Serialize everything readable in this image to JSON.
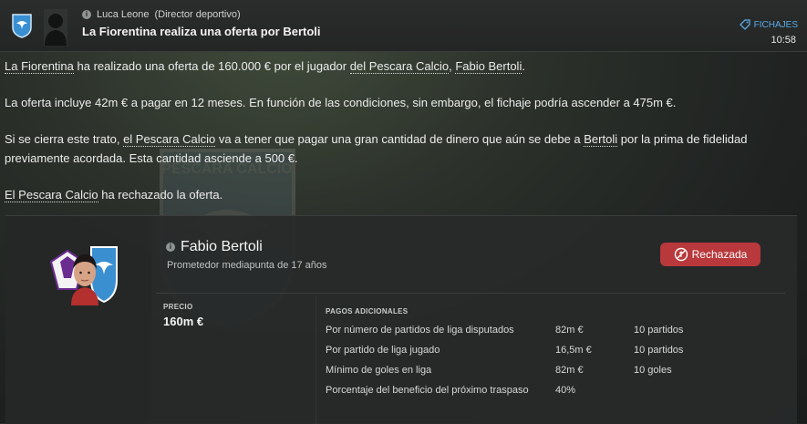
{
  "header": {
    "sender_name": "Luca Leone",
    "sender_role": "(Director deportivo)",
    "subject": "La Fiorentina realiza una oferta por Bertoli",
    "tag_label": "FICHAJES",
    "time": "10:58"
  },
  "body": {
    "p1": {
      "club_a": "La Fiorentina",
      "t1": " ha realizado una oferta de 160.000 € por el jugador ",
      "club_b": "del Pescara Calcio",
      "t2": ", ",
      "player": "Fabio Bertoli",
      "t3": "."
    },
    "p2": "La oferta incluye 42m € a pagar en 12 meses. En función de las condiciones, sin embargo, el fichaje podría ascender a 475m €.",
    "p3": {
      "t1": "Si se cierra este trato, ",
      "club": "el Pescara Calcio",
      "t2": " va a tener que pagar una gran cantidad de dinero que aún se debe a ",
      "player": "Bertoli",
      "t3": " por la prima de fidelidad previamente acordada. Esta cantidad asciende a 500 €."
    },
    "p4": {
      "club": "El Pescara Calcio",
      "t1": " ha rechazado la oferta."
    }
  },
  "watermark_text": "PESCARA CALCIO",
  "card": {
    "player_name": "Fabio Bertoli",
    "player_desc": "Prometedor mediapunta de 17 años",
    "status_label": "Rechazada",
    "price_label": "PRECIO",
    "price_value": "160m €",
    "payments_label": "PAGOS ADICIONALES",
    "payments": [
      {
        "desc": "Por número de partidos de liga disputados",
        "amount": "82m €",
        "cond": "10 partidos"
      },
      {
        "desc": "Por partido de liga jugado",
        "amount": "16,5m €",
        "cond": "10 partidos"
      },
      {
        "desc": "Mínimo de goles en liga",
        "amount": "82m €",
        "cond": "10 goles"
      },
      {
        "desc": "Porcentaje del beneficio del próximo traspaso",
        "amount": "40%",
        "cond": ""
      }
    ]
  },
  "colors": {
    "accent": "#5aa9e6",
    "reject": "#b8383b",
    "fiorentina": "#6a2c91",
    "pescara": "#3a8fd1"
  },
  "icons": [
    "club-crest-icon",
    "info-icon",
    "tag-icon",
    "reject-icon"
  ]
}
